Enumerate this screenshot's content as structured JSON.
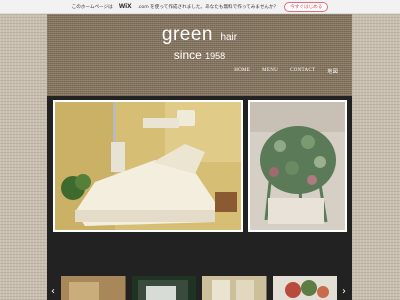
{
  "wix_banner": {
    "text_before": "このホームページは",
    "logo": "WiX",
    "text_after": ".com を使って作成されました。あなたも無料で作ってみませんか？",
    "button": "今すぐはじめる"
  },
  "brand": {
    "name": "green",
    "sub": "hair",
    "since": "since",
    "year": "1958"
  },
  "nav": [
    "HOME",
    "MENU",
    "CONTACT",
    "地図"
  ],
  "gallery": {
    "prev_icon": "chevron-left-icon",
    "next_icon": "chevron-right-icon"
  },
  "colors": {
    "column": "#8a7a66",
    "gallery_bg": "#222222",
    "wix_button": "#d9465a"
  }
}
